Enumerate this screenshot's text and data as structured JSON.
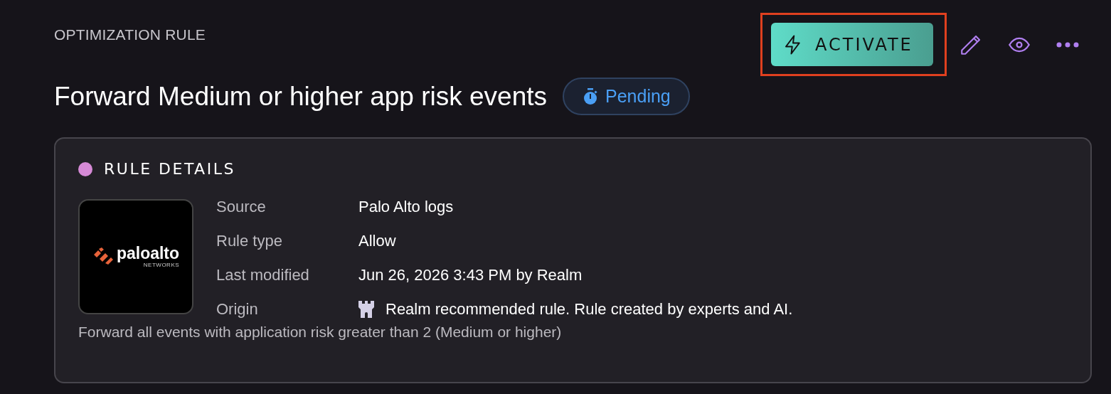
{
  "header": {
    "label": "OPTIMIZATION RULE",
    "title": "Forward Medium or higher app risk events"
  },
  "status": {
    "kind": "pending",
    "label": "Pending"
  },
  "actions": [
    {
      "kind": "activate",
      "label": "ACTIVATE",
      "highlighted": true
    },
    {
      "kind": "edit"
    },
    {
      "kind": "view"
    },
    {
      "kind": "more"
    }
  ],
  "card": {
    "title": "RULE DETAILS",
    "color": "#d68ad6",
    "logo": {
      "wordmark": "paloalto",
      "subline": "NETWORKS"
    },
    "fields": [
      {
        "label": "Source",
        "value": "Palo Alto logs"
      },
      {
        "label": "Rule type",
        "value": "Allow"
      },
      {
        "label": "Last modified",
        "value": "Jun 26, 2026 3:43 PM by Realm"
      },
      {
        "label": "Origin",
        "value": "Realm recommended rule. Rule created by experts and AI.",
        "kind": "origin"
      }
    ],
    "description": "Forward all events with application risk greater than 2 (Medium or higher)"
  }
}
